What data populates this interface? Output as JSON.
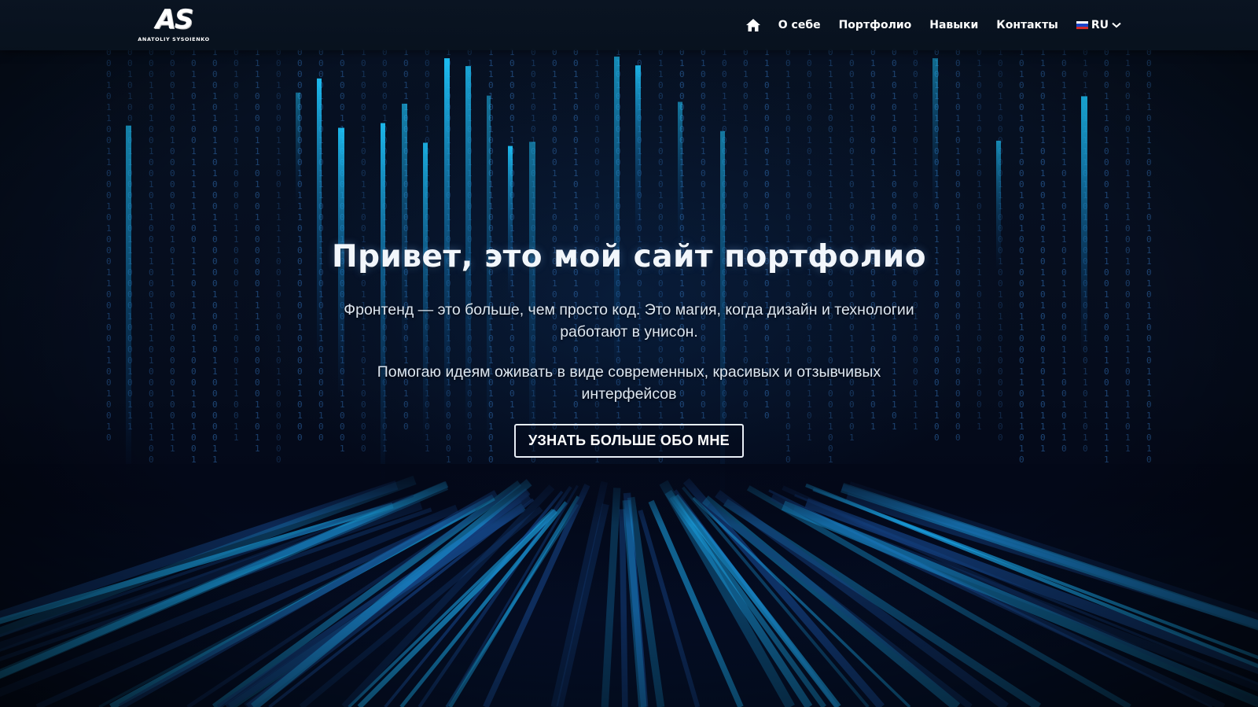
{
  "brand": {
    "logo_text": "AS",
    "logo_subtitle": "ANATOLIY SYSOIENKO"
  },
  "nav": {
    "home_icon": "home-icon",
    "links": [
      {
        "label": "О себе"
      },
      {
        "label": "Портфолио"
      },
      {
        "label": "Навыки"
      },
      {
        "label": "Контакты"
      }
    ],
    "language": {
      "label": "RU",
      "flag_icon": "russia-flag-icon",
      "chevron_icon": "chevron-down-icon"
    }
  },
  "hero": {
    "title": "Привет, это мой сайт портфолио",
    "paragraph_1": "Фронтенд — это больше, чем просто код. Это магия, когда дизайн и технологии работают в унисон.",
    "paragraph_2": "Помогаю идеям оживать в виде современных, красивых и отзывчивых интерфейсов",
    "cta_label": "УЗНАТЬ БОЛЬШЕ ОБО МНЕ"
  },
  "colors": {
    "background": "#050c1c",
    "accent": "#19b8ff",
    "text": "#ffffff"
  }
}
